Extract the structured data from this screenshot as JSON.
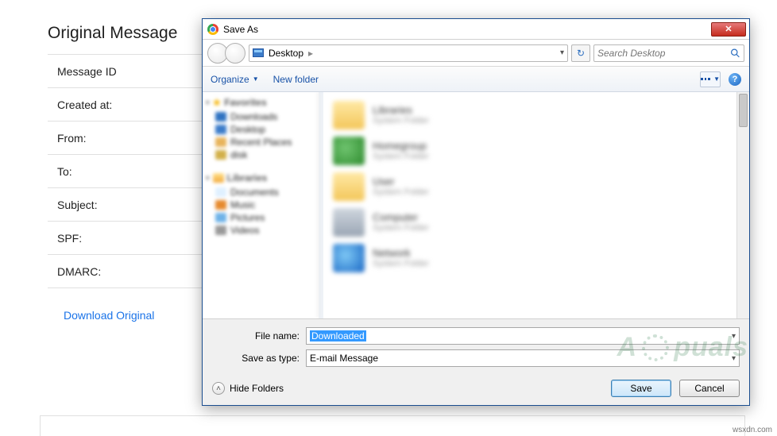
{
  "page": {
    "title": "Original Message",
    "rows": {
      "message_id": "Message ID",
      "created_at": "Created at:",
      "from": "From:",
      "to": "To:",
      "subject": "Subject:",
      "spf": "SPF:",
      "dmarc": "DMARC:"
    },
    "download_link": "Download Original"
  },
  "dialog": {
    "title": "Save As",
    "address": {
      "location": "Desktop"
    },
    "search": {
      "placeholder": "Search Desktop"
    },
    "toolbar": {
      "organize": "Organize",
      "new_folder": "New folder"
    },
    "tree": {
      "favorites": {
        "label": "Favorites",
        "items": [
          "Downloads",
          "Desktop",
          "Recent Places",
          "disk"
        ]
      },
      "libraries": {
        "label": "Libraries",
        "items": [
          "Documents",
          "Music",
          "Pictures",
          "Videos"
        ]
      }
    },
    "files": [
      {
        "name": "Libraries",
        "sub": "System Folder"
      },
      {
        "name": "Homegroup",
        "sub": "System Folder"
      },
      {
        "name": "User",
        "sub": "System Folder"
      },
      {
        "name": "Computer",
        "sub": "System Folder"
      },
      {
        "name": "Network",
        "sub": "System Folder"
      }
    ],
    "file_name_label": "File name:",
    "file_name_value": "Downloaded",
    "save_type_label": "Save as type:",
    "save_type_value": "E-mail Message",
    "hide_folders": "Hide Folders",
    "save": "Save",
    "cancel": "Cancel"
  },
  "watermark": "A   puals",
  "credit": "wsxdn.com"
}
